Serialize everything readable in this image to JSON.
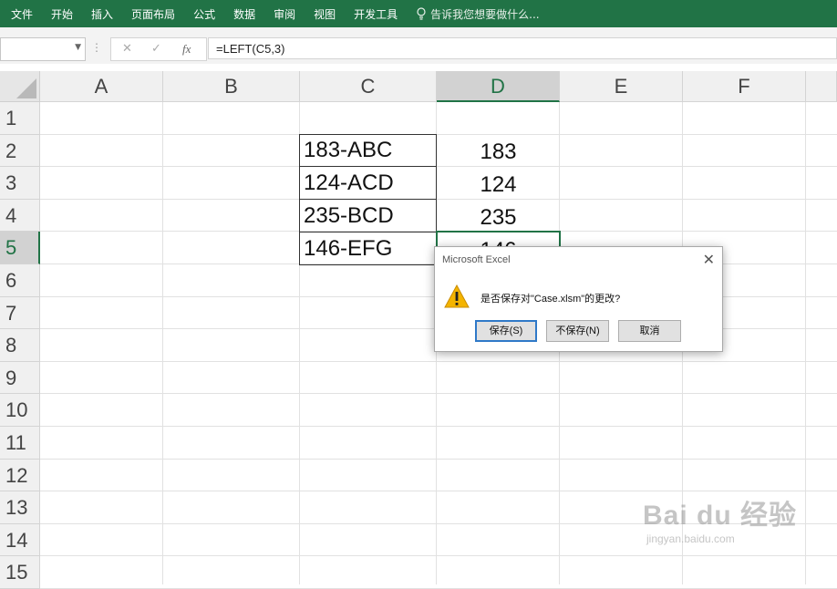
{
  "ribbon": {
    "tabs": [
      "文件",
      "开始",
      "插入",
      "页面布局",
      "公式",
      "数据",
      "审阅",
      "视图",
      "开发工具"
    ],
    "tell_me": "告诉我您想要做什么..."
  },
  "formula_bar": {
    "name_box": "",
    "cancel_symbol": "✕",
    "enter_symbol": "✓",
    "fx_symbol": "fx",
    "formula": "=LEFT(C5,3)"
  },
  "columns": [
    "A",
    "B",
    "C",
    "D",
    "E",
    "F"
  ],
  "rows": [
    "1",
    "2",
    "3",
    "4",
    "5",
    "6",
    "7",
    "8",
    "9",
    "10",
    "11",
    "12",
    "13",
    "14",
    "15"
  ],
  "cells": {
    "C2": "183-ABC",
    "C3": "124-ACD",
    "C4": "235-BCD",
    "C5": "146-EFG",
    "D2": "183",
    "D3": "124",
    "D4": "235",
    "D5": "146"
  },
  "dialog": {
    "title": "Microsoft Excel",
    "close_symbol": "✕",
    "message": "是否保存对\"Case.xlsm\"的更改?",
    "buttons": [
      "保存(S)",
      "不保存(N)",
      "取消"
    ],
    "icon": "warning-icon"
  },
  "watermark": {
    "logo": "Bai du 经验",
    "url": "jingyan.baidu.com"
  },
  "colors": {
    "ribbon": "#217346",
    "accent": "#217346",
    "dialog_default_border": "#2f79c8"
  }
}
